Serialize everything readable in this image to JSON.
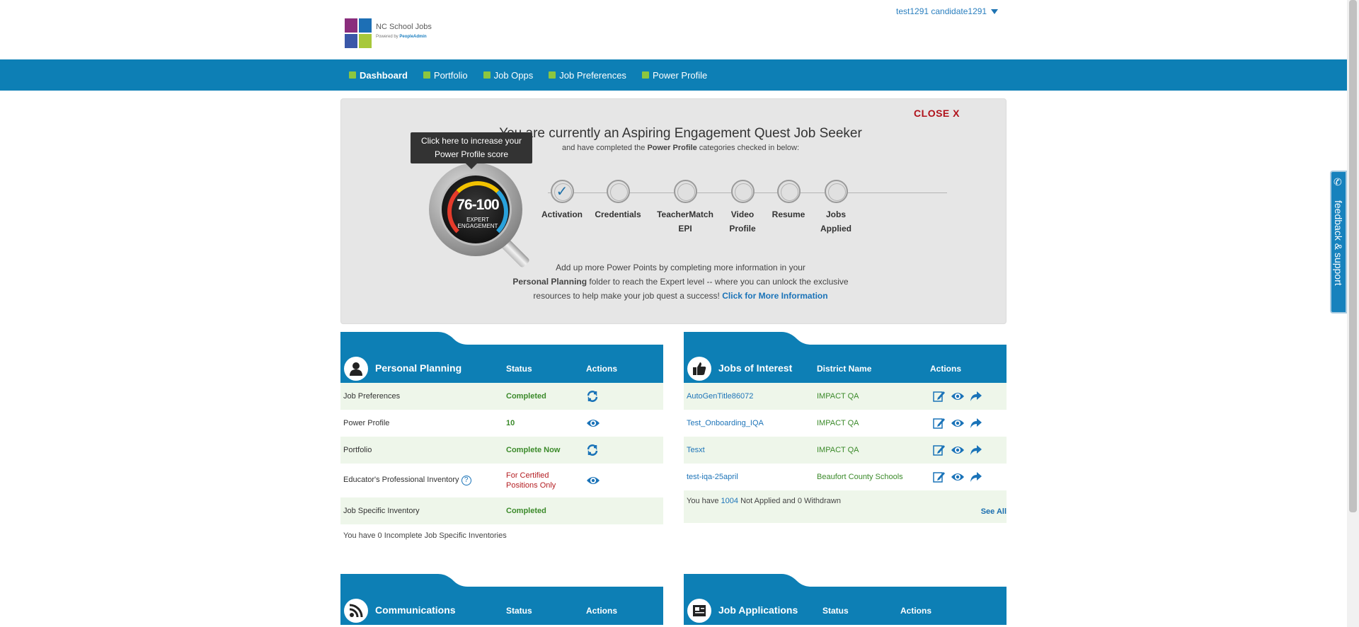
{
  "header": {
    "logo_title": "NC School Jobs",
    "logo_powered": "Powered by",
    "logo_brand": "PeopleAdmin",
    "user_name": "test1291 candidate1291"
  },
  "nav": {
    "items": [
      "Dashboard",
      "Portfolio",
      "Job Opps",
      "Job Preferences",
      "Power Profile"
    ]
  },
  "engagement": {
    "close_label": "CLOSE X",
    "title": "You are currently an Aspiring Engagement Quest Job Seeker",
    "subtitle_pre": "and have completed the",
    "subtitle_bold": "Power Profile",
    "subtitle_post": "categories checked in below:",
    "tooltip_line1": "Click here to increase your",
    "tooltip_line2": "Power Profile score",
    "gauge_score": "76-100",
    "gauge_label1": "EXPERT",
    "gauge_label2": "ENGAGEMENT",
    "steps": [
      {
        "label": "Activation",
        "checked": true
      },
      {
        "label": "Credentials",
        "checked": false
      },
      {
        "label": "TeacherMatch EPI",
        "checked": false
      },
      {
        "label": "Video Profile",
        "checked": false
      },
      {
        "label": "Resume",
        "checked": false
      },
      {
        "label": "Jobs Applied",
        "checked": false
      }
    ],
    "text_line1": "Add up more Power Points by completing more information in your",
    "text_bold": "Personal Planning",
    "text_line2": "folder to reach the Expert level -- where you can unlock the exclusive",
    "text_line3": "resources to help make your job quest a success!",
    "more_link": "Click for More Information"
  },
  "personal_planning": {
    "title": "Personal Planning",
    "col_status": "Status",
    "col_actions": "Actions",
    "rows": [
      {
        "name": "Job Preferences",
        "status": "Completed",
        "action": "refresh-icon"
      },
      {
        "name": "Power Profile",
        "status": "10",
        "action": "view-icon"
      },
      {
        "name": "Portfolio",
        "status": "Complete Now",
        "action": "refresh-icon"
      },
      {
        "name": "Educator's Professional Inventory",
        "status": "For Certified Positions Only",
        "action": "view-icon"
      },
      {
        "name": "Job Specific Inventory",
        "status": "Completed",
        "action": ""
      }
    ],
    "note": "You have 0 Incomplete Job Specific Inventories"
  },
  "jobs_of_interest": {
    "title": "Jobs of Interest",
    "col_district": "District Name",
    "col_actions": "Actions",
    "rows": [
      {
        "job": "AutoGenTitle86072",
        "district": "IMPACT QA"
      },
      {
        "job": "Test_Onboarding_IQA",
        "district": "IMPACT QA"
      },
      {
        "job": "Tesxt",
        "district": "IMPACT QA"
      },
      {
        "job": "test-iqa-25april",
        "district": "Beaufort County Schools"
      }
    ],
    "note_pre": "You have",
    "note_count": "1004",
    "note_post": "Not Applied and 0 Withdrawn",
    "see_all": "See All"
  },
  "communications": {
    "title": "Communications",
    "col_status": "Status",
    "col_actions": "Actions"
  },
  "job_applications": {
    "title": "Job Applications",
    "col_status": "Status",
    "col_actions": "Actions"
  },
  "feedback": {
    "label": "feedback & support"
  },
  "colors": {
    "brand_blue": "#0d7fb5",
    "nav_square": "#8cc63f",
    "status_green": "#3b8a2a",
    "close_red": "#b0111a"
  }
}
